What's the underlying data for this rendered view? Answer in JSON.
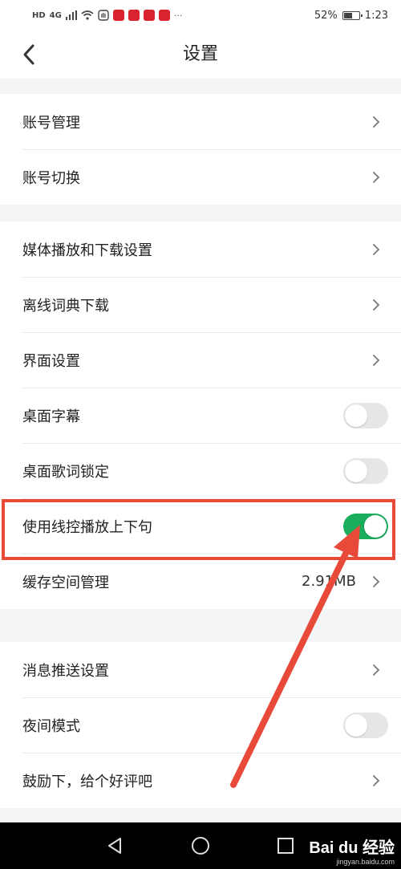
{
  "status_bar": {
    "network_tag": "HD",
    "signal_tag": "4G",
    "battery_percent": "52%",
    "time": "1:23",
    "more": "···"
  },
  "header": {
    "title": "设置",
    "back_icon": "chevron-left-icon"
  },
  "groups": [
    {
      "items": [
        {
          "label": "账号管理",
          "control": "chevron"
        },
        {
          "label": "账号切换",
          "control": "chevron"
        }
      ]
    },
    {
      "items": [
        {
          "label": "媒体播放和下载设置",
          "control": "chevron"
        },
        {
          "label": "离线词典下载",
          "control": "chevron"
        },
        {
          "label": "界面设置",
          "control": "chevron"
        },
        {
          "label": "桌面字幕",
          "control": "toggle",
          "enabled": false
        },
        {
          "label": "桌面歌词锁定",
          "control": "toggle",
          "enabled": false
        },
        {
          "label": "使用线控播放上下句",
          "control": "toggle",
          "enabled": true
        },
        {
          "label": "缓存空间管理",
          "control": "chevron",
          "value": "2.91MB"
        }
      ]
    },
    {
      "items": [
        {
          "label": "消息推送设置",
          "control": "chevron"
        },
        {
          "label": "夜间模式",
          "control": "toggle",
          "enabled": false
        },
        {
          "label": "鼓励下，给个好评吧",
          "control": "chevron"
        }
      ]
    }
  ],
  "colors": {
    "toggle_on": "#1aad5e",
    "toggle_off": "#e6e6e6",
    "annotation": "#e84a3a",
    "page_bg": "#f4f5f7"
  },
  "nav_bar": {
    "back_icon": "triangle-back-icon",
    "home_icon": "circle-home-icon",
    "recents_icon": "square-recents-icon"
  },
  "watermark": {
    "logo": "Bai du 经验",
    "url": "jingyan.baidu.com"
  }
}
